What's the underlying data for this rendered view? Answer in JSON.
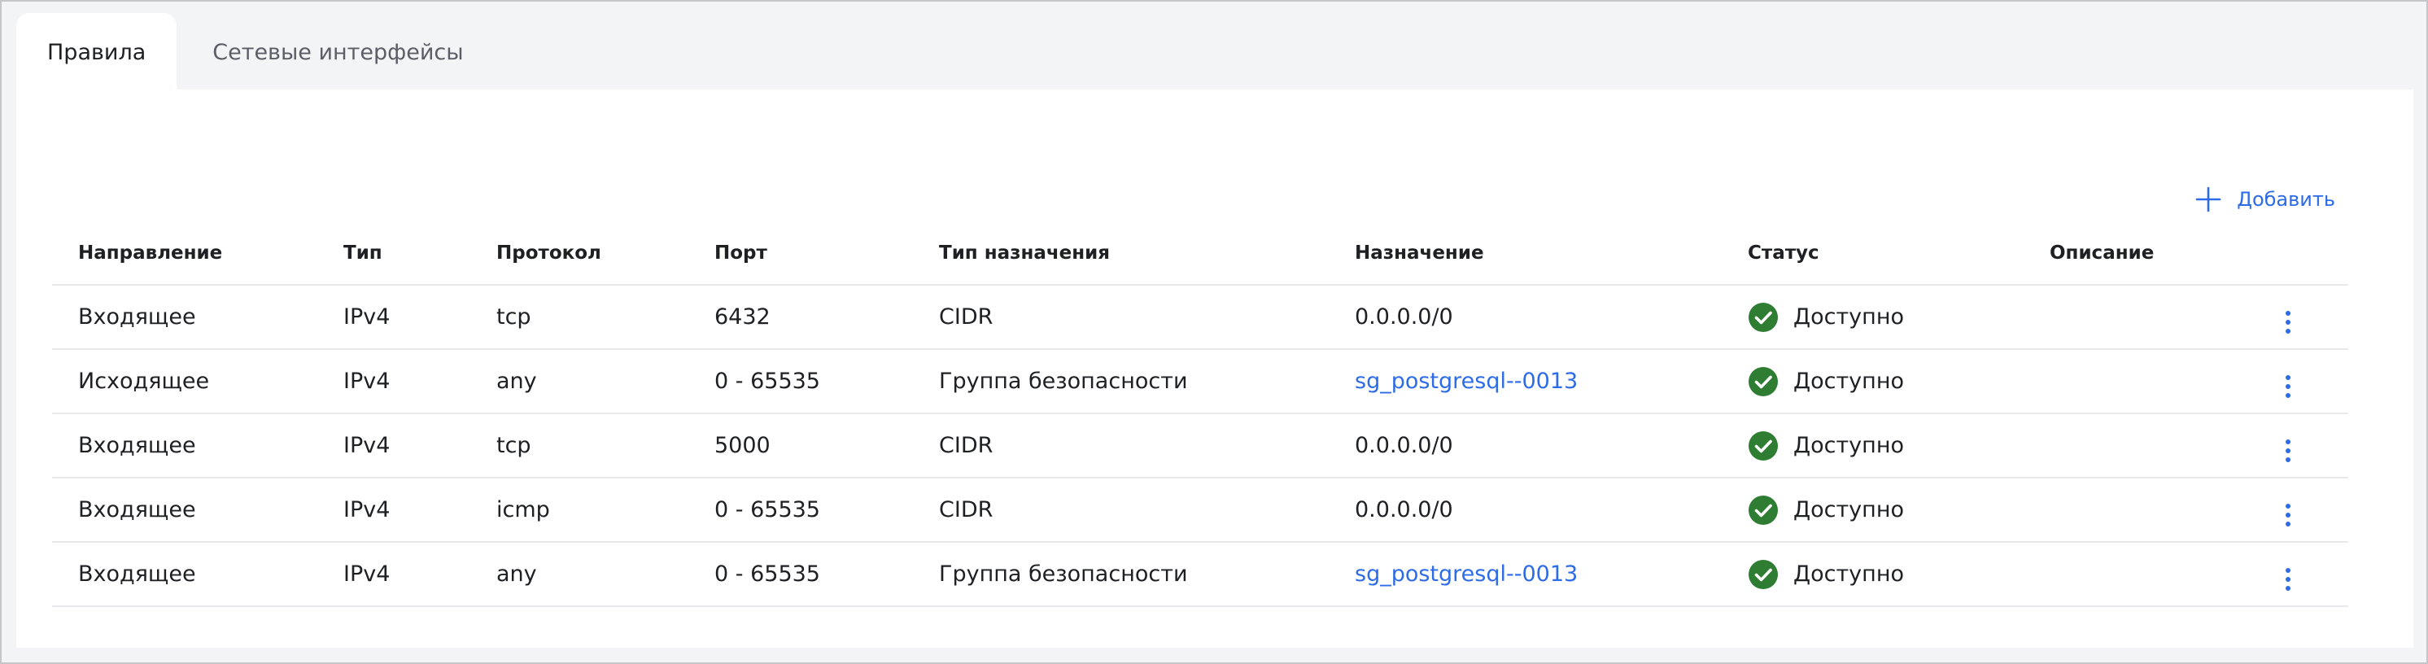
{
  "tabs": [
    {
      "label": "Правила",
      "active": true
    },
    {
      "label": "Сетевые интерфейсы",
      "active": false
    }
  ],
  "toolbar": {
    "add_label": "Добавить",
    "add_icon": "plus-icon"
  },
  "colors": {
    "accent": "#2e6be6",
    "status_ok": "#2e7d32",
    "background": "#f3f4f6",
    "panel": "#ffffff"
  },
  "table": {
    "columns": [
      "Направление",
      "Тип",
      "Протокол",
      "Порт",
      "Тип назначения",
      "Назначение",
      "Статус",
      "Описание"
    ],
    "rows": [
      {
        "direction": "Входящее",
        "type": "IPv4",
        "protocol": "tcp",
        "port": "6432",
        "dest_type": "CIDR",
        "dest": "0.0.0.0/0",
        "dest_is_link": false,
        "status": "Доступно",
        "description": ""
      },
      {
        "direction": "Исходящее",
        "type": "IPv4",
        "protocol": "any",
        "port": "0 - 65535",
        "dest_type": "Группа безопасности",
        "dest": "sg_postgresql--0013",
        "dest_is_link": true,
        "status": "Доступно",
        "description": ""
      },
      {
        "direction": "Входящее",
        "type": "IPv4",
        "protocol": "tcp",
        "port": "5000",
        "dest_type": "CIDR",
        "dest": "0.0.0.0/0",
        "dest_is_link": false,
        "status": "Доступно",
        "description": ""
      },
      {
        "direction": "Входящее",
        "type": "IPv4",
        "protocol": "icmp",
        "port": "0 - 65535",
        "dest_type": "CIDR",
        "dest": "0.0.0.0/0",
        "dest_is_link": false,
        "status": "Доступно",
        "description": ""
      },
      {
        "direction": "Входящее",
        "type": "IPv4",
        "protocol": "any",
        "port": "0 - 65535",
        "dest_type": "Группа безопасности",
        "dest": "sg_postgresql--0013",
        "dest_is_link": true,
        "status": "Доступно",
        "description": ""
      }
    ]
  }
}
